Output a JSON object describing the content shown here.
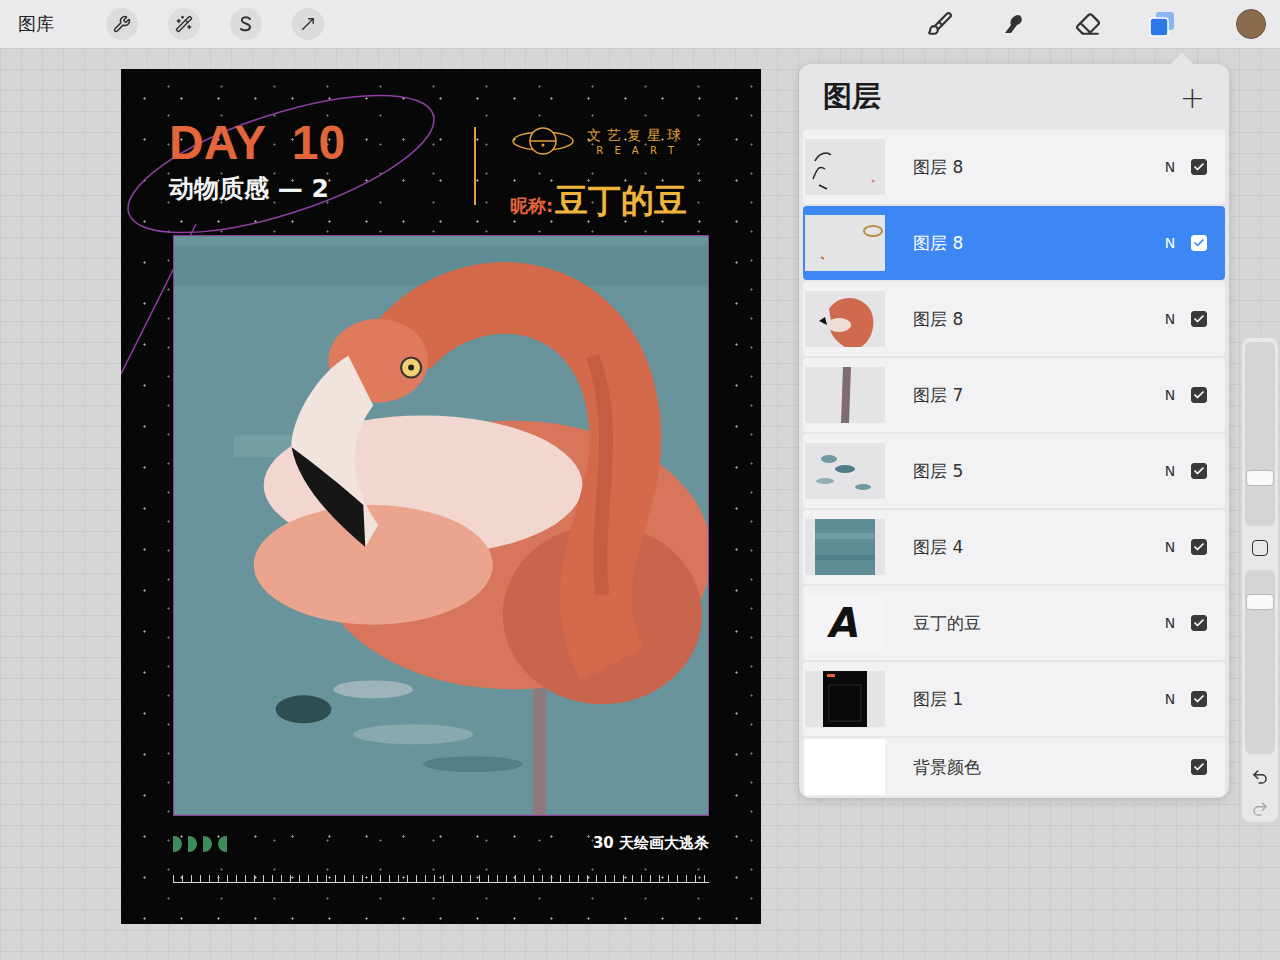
{
  "toolbar": {
    "gallery": "图库"
  },
  "poster": {
    "day": "DAY  10",
    "subtitle": "动物质感 — 2",
    "logo_cn": "文艺复星球",
    "logo_en": "R E A R T",
    "nickname_label": "昵称:",
    "nickname": "豆丁的豆",
    "footer": "30 天绘画大逃杀"
  },
  "layers_panel": {
    "title": "图层",
    "add": "+",
    "layers": [
      {
        "name": "图层 8",
        "blend": "N",
        "visible": true,
        "selected": false,
        "thumb": "sketch"
      },
      {
        "name": "图层 8",
        "blend": "N",
        "visible": true,
        "selected": true,
        "thumb": "ring"
      },
      {
        "name": "图层 8",
        "blend": "N",
        "visible": true,
        "selected": false,
        "thumb": "bird"
      },
      {
        "name": "图层 7",
        "blend": "N",
        "visible": true,
        "selected": false,
        "thumb": "leg"
      },
      {
        "name": "图层 5",
        "blend": "N",
        "visible": true,
        "selected": false,
        "thumb": "dabs"
      },
      {
        "name": "图层 4",
        "blend": "N",
        "visible": true,
        "selected": false,
        "thumb": "water"
      },
      {
        "name": "豆丁的豆",
        "blend": "N",
        "visible": true,
        "selected": false,
        "thumb": "text",
        "glyph": "A"
      },
      {
        "name": "图层 1",
        "blend": "N",
        "visible": true,
        "selected": false,
        "thumb": "poster"
      },
      {
        "name": "背景颜色",
        "visible": true,
        "selected": false,
        "thumb": "white"
      }
    ]
  },
  "sidebar": {
    "size_level": 0.24,
    "opacity_level": 0.86
  }
}
